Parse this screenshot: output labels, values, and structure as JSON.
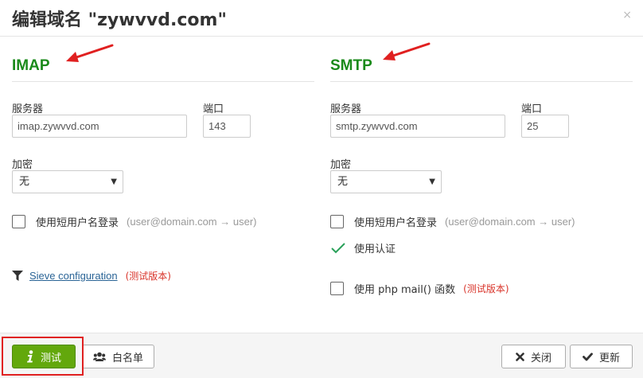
{
  "dialog": {
    "title": "编辑域名 \"zywvvd.com\"",
    "close_glyph": "×"
  },
  "imap": {
    "heading": "IMAP",
    "server_label": "服务器",
    "server_value": "imap.zywvvd.com",
    "port_label": "端口",
    "port_value": "143",
    "encryption_label": "加密",
    "encryption_value": "无",
    "short_username_label": "使用短用户名登录",
    "short_username_hint": "(user@domain.com → user)",
    "sieve_link": "Sieve configuration",
    "sieve_beta": "(测试版本)"
  },
  "smtp": {
    "heading": "SMTP",
    "server_label": "服务器",
    "server_value": "smtp.zywvvd.com",
    "port_label": "端口",
    "port_value": "25",
    "encryption_label": "加密",
    "encryption_value": "无",
    "short_username_label": "使用短用户名登录",
    "short_username_hint": "(user@domain.com → user)",
    "use_auth_label": "使用认证",
    "php_mail_label": "使用 php mail() 函数",
    "php_mail_beta": "(测试版本)"
  },
  "footer": {
    "test_label": "测试",
    "whitelist_label": "白名单",
    "close_label": "关闭",
    "update_label": "更新"
  },
  "colors": {
    "heading_green": "#1a8a1a",
    "test_button_green": "#63a80c",
    "beta_red": "#d9342a",
    "annotation_red": "#e02020",
    "link_blue": "#2a6496"
  },
  "icons": {
    "test": "info-icon",
    "whitelist": "users-icon",
    "close": "x-icon",
    "update": "check-icon",
    "sieve": "filter-icon",
    "auth": "checkmark-icon"
  }
}
